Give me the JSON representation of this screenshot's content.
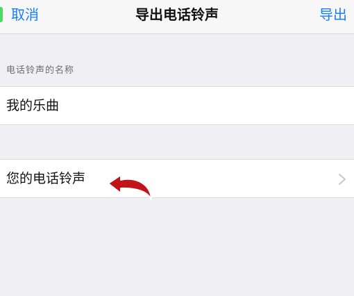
{
  "nav": {
    "cancel_label": "取消",
    "title": "导出电话铃声",
    "export_label": "导出"
  },
  "form": {
    "section_header": "电话铃声的名称",
    "ringtone_name_value": "我的乐曲"
  },
  "list": {
    "ringtones_label": "您的电话铃声",
    "chevron_icon": "chevron-right-icon"
  },
  "colors": {
    "accent": "#157efb",
    "background": "#efeff4",
    "annotation_arrow": "#c0141a",
    "status_green": "#4cd964"
  }
}
